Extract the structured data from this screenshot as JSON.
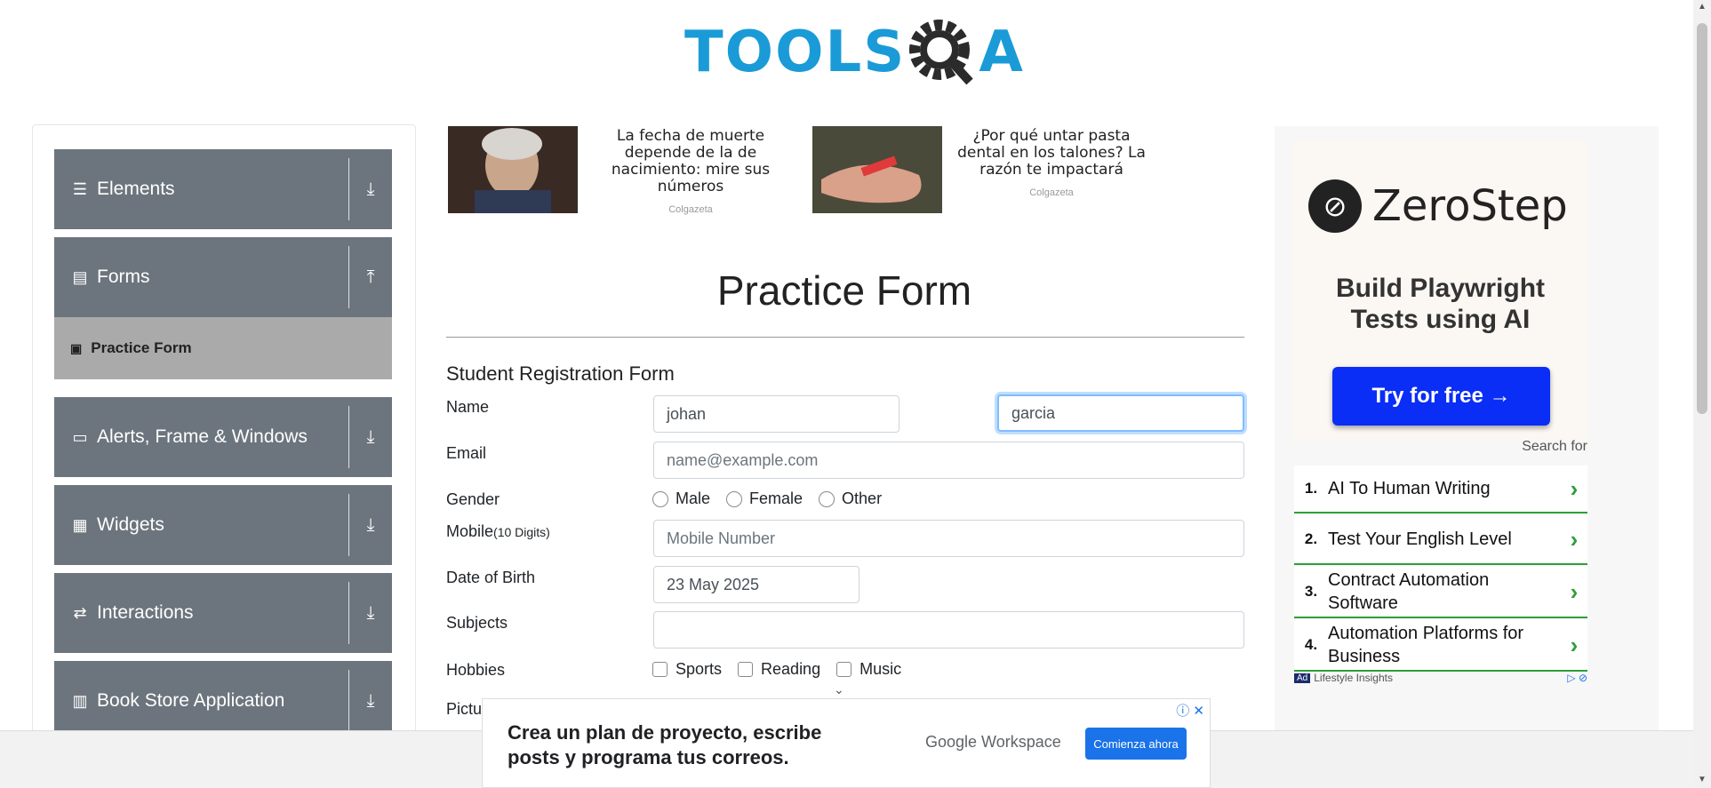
{
  "logo": {
    "text_blue": "TOOLS",
    "text_dark": "A"
  },
  "sidebar": {
    "groups": [
      {
        "label": "Elements",
        "icon": "hamburger-icon"
      },
      {
        "label": "Forms",
        "icon": "document-icon"
      },
      {
        "label": "Alerts, Frame & Windows",
        "icon": "window-icon"
      },
      {
        "label": "Widgets",
        "icon": "widgets-icon"
      },
      {
        "label": "Interactions",
        "icon": "interactions-icon"
      },
      {
        "label": "Book Store Application",
        "icon": "books-icon"
      }
    ],
    "active_item": "Practice Form"
  },
  "promos": [
    {
      "caption": "La fecha de muerte depende de la de nacimiento: mire sus números",
      "source": "Colgazeta"
    },
    {
      "caption": "¿Por qué untar pasta dental en los talones? La razón te impactará",
      "source": "Colgazeta"
    }
  ],
  "form": {
    "title": "Practice Form",
    "subtitle": "Student Registration Form",
    "labels": {
      "name": "Name",
      "email": "Email",
      "gender": "Gender",
      "mobile": "Mobile",
      "mobile_hint": "(10 Digits)",
      "dob": "Date of Birth",
      "subjects": "Subjects",
      "hobbies": "Hobbies",
      "picture": "Pictu"
    },
    "first_name": "johan",
    "last_name": "garcia",
    "email_placeholder": "name@example.com",
    "mobile_placeholder": "Mobile Number",
    "dob_value": "23 May 2025",
    "gender_options": [
      "Male",
      "Female",
      "Other"
    ],
    "hobby_options": [
      "Sports",
      "Reading",
      "Music"
    ]
  },
  "right_ad": {
    "brand": "ZeroStep",
    "headline_1": "Build Playwright",
    "headline_2": "Tests using AI",
    "cta": "Try for free →",
    "search_for": "Search for",
    "results": [
      {
        "num": "1.",
        "text": "AI To Human Writing"
      },
      {
        "num": "2.",
        "text": "Test Your English Level"
      },
      {
        "num": "3.",
        "text": "Contract Automation Software"
      },
      {
        "num": "4.",
        "text": "Automation Platforms for Business"
      }
    ],
    "footer_tag": "Ad",
    "footer_text": "Lifestyle Insights"
  },
  "bottom_ad": {
    "line1": "Crea un  plan de proyecto,  escribe",
    "line2": "posts y programa tus  correos.",
    "brand": "Google Workspace",
    "cta": "Comienza ahora"
  }
}
